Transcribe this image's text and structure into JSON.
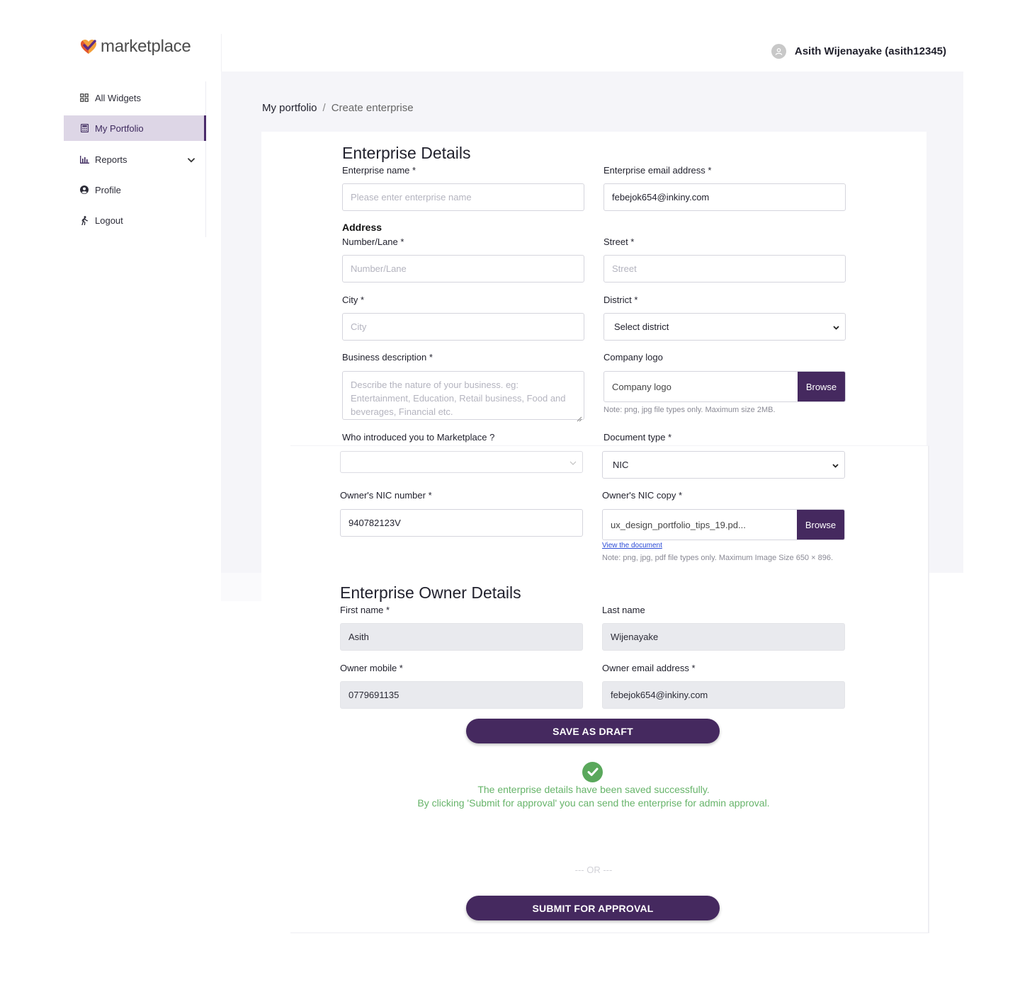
{
  "brand": {
    "name": "marketplace"
  },
  "user": {
    "display": "Asith Wijenayake (asith12345)"
  },
  "sidebar": {
    "items": [
      {
        "label": "All Widgets",
        "icon": "grid-icon"
      },
      {
        "label": "My Portfolio",
        "icon": "calculator-icon",
        "active": true
      },
      {
        "label": "Reports",
        "icon": "bar-chart-icon",
        "expandable": true
      },
      {
        "label": "Profile",
        "icon": "user-circle-icon"
      },
      {
        "label": "Logout",
        "icon": "walking-person-icon"
      }
    ]
  },
  "breadcrumb": {
    "parent": "My portfolio",
    "separator": "/",
    "current": "Create enterprise"
  },
  "enterprise": {
    "title": "Enterprise Details",
    "name_label": "Enterprise name *",
    "name_placeholder": "Please enter enterprise name",
    "email_label": "Enterprise email address *",
    "email_value": "febejok654@inkiny.com",
    "address_heading": "Address",
    "lane_label": "Number/Lane *",
    "lane_placeholder": "Number/Lane",
    "street_label": "Street *",
    "street_placeholder": "Street",
    "city_label": "City *",
    "city_placeholder": "City",
    "district_label": "District *",
    "district_value": "Select district",
    "description_label": "Business description *",
    "description_placeholder": "Describe the nature of your business. eg: Entertainment, Education, Retail business, Food and beverages, Financial etc.",
    "logo_label": "Company logo",
    "logo_file": "Company logo",
    "logo_browse": "Browse",
    "logo_note": "Note: png, jpg file types only. Maximum size 2MB.",
    "introduced_label": "Who introduced you to Marketplace ?",
    "introduced_value": "",
    "doctype_label": "Document type *",
    "doctype_value": "NIC",
    "nic_label": "Owner's NIC number *",
    "nic_value": "940782123V",
    "nic_copy_label": "Owner's NIC copy *",
    "nic_copy_file": "ux_design_portfolio_tips_19.pd...",
    "nic_copy_browse": "Browse",
    "view_document": "View the document",
    "nic_copy_note": "Note: png, jpg, pdf file types only. Maximum Image Size 650 × 896."
  },
  "owner": {
    "title": "Enterprise Owner Details",
    "first_label": "First name *",
    "first_value": "Asith",
    "last_label": "Last name",
    "last_value": "Wijenayake",
    "mobile_label": "Owner mobile *",
    "mobile_value": "0779691135",
    "email_label": "Owner email address *",
    "email_value": "febejok654@inkiny.com"
  },
  "actions": {
    "save_draft": "SAVE AS DRAFT",
    "success_line1": "The enterprise details have been saved successfully.",
    "success_line2": "By clicking 'Submit for approval' you can send the enterprise for admin approval.",
    "or_text": "--- OR ---",
    "submit": "SUBMIT FOR APPROVAL"
  },
  "colors": {
    "primary": "#45295f",
    "active_nav_bg": "#ddd6e6",
    "success": "#5aa85c",
    "page_bg": "#f5f5f9"
  }
}
